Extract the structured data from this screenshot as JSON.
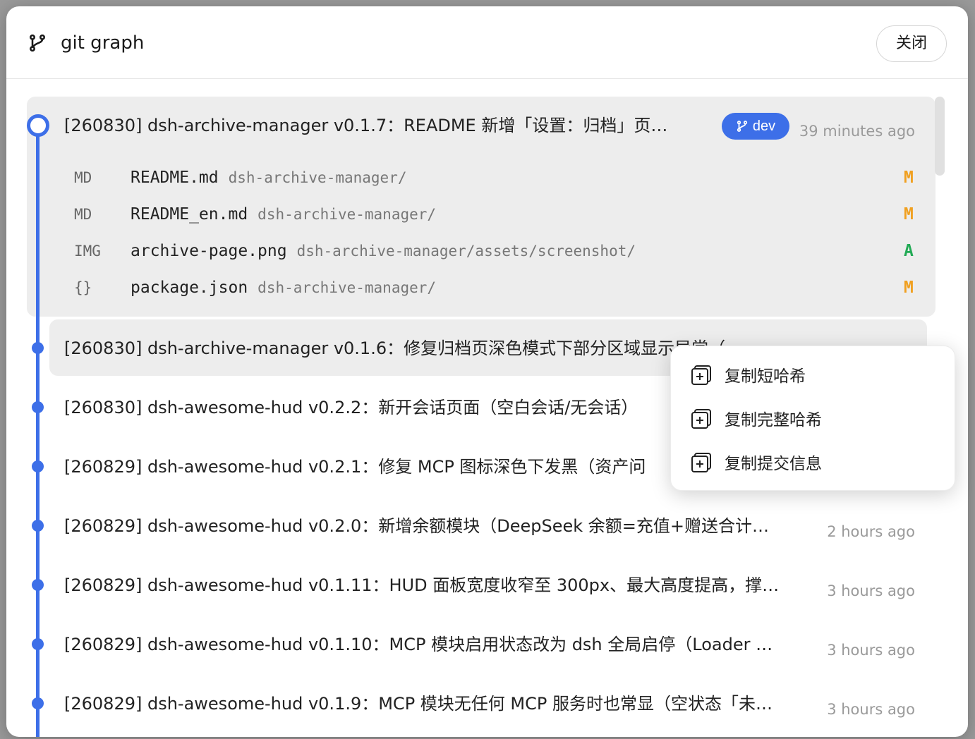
{
  "dialog": {
    "title": "git graph",
    "close_label": "关闭"
  },
  "colors": {
    "accent": "#3d6fe8",
    "modified": "#f0a020",
    "added": "#22aa55"
  },
  "expanded_commit": {
    "message": "[260830] dsh-archive-manager v0.1.7：README 新增「设置：归档」页…",
    "branch": "dev",
    "time": "39 minutes ago",
    "files": [
      {
        "type": "MD",
        "name": "README.md",
        "path": "dsh-archive-manager/",
        "status": "M"
      },
      {
        "type": "MD",
        "name": "README_en.md",
        "path": "dsh-archive-manager/",
        "status": "M"
      },
      {
        "type": "IMG",
        "name": "archive-page.png",
        "path": "dsh-archive-manager/assets/screenshot/",
        "status": "A"
      },
      {
        "type": "{}",
        "name": "package.json",
        "path": "dsh-archive-manager/",
        "status": "M"
      }
    ]
  },
  "commits": [
    {
      "message": "[260830] dsh-archive-manager v0.1.6：修复归档页深色模式下部分区域显示异常（",
      "time": ""
    },
    {
      "message": "[260830] dsh-awesome-hud v0.2.2：新开会话页面（空白会话/无会话）",
      "time": ""
    },
    {
      "message": "[260829] dsh-awesome-hud v0.2.1：修复 MCP 图标深色下发黑（资产问",
      "time": ""
    },
    {
      "message": "[260829] dsh-awesome-hud v0.2.0：新增余额模块（DeepSeek 余额=充值+赠送合计…",
      "time": "2 hours ago"
    },
    {
      "message": "[260829] dsh-awesome-hud v0.1.11：HUD 面板宽度收窄至 300px、最大高度提高，撑…",
      "time": "3 hours ago"
    },
    {
      "message": "[260829] dsh-awesome-hud v0.1.10：MCP 模块启用状态改为 dsh 全局启停（Loader …",
      "time": "3 hours ago"
    },
    {
      "message": "[260829] dsh-awesome-hud v0.1.9：MCP 模块无任何 MCP 服务时也常显（空状态「未…",
      "time": "3 hours ago"
    }
  ],
  "context_menu": {
    "items": [
      {
        "label": "复制短哈希",
        "icon": "copy-icon"
      },
      {
        "label": "复制完整哈希",
        "icon": "copy-icon"
      },
      {
        "label": "复制提交信息",
        "icon": "copy-icon"
      }
    ]
  }
}
